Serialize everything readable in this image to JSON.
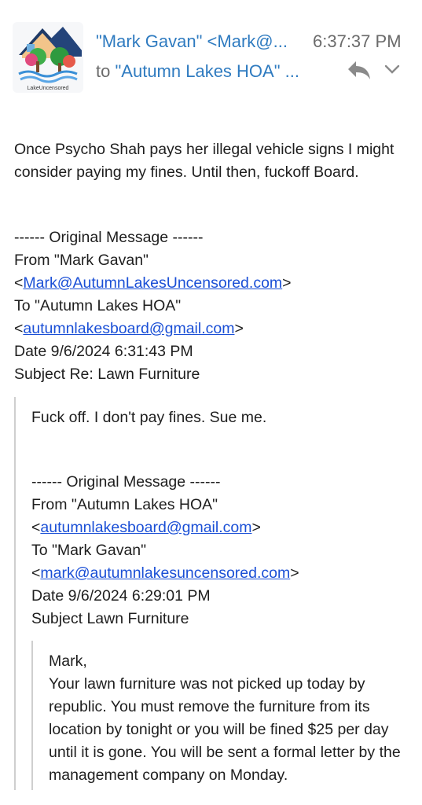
{
  "header": {
    "from": "\"Mark Gavan\" <Mark@...",
    "time": "6:37:37 PM",
    "to_prefix": "to",
    "to_name": "\"Autumn Lakes HOA\" ...",
    "avatar_caption": "LakeUncensored"
  },
  "message": {
    "body": "Once Psycho Shah pays her illegal vehicle signs I might consider paying my fines. Until then, fuckoff Board.",
    "original": {
      "separator": "------ Original Message ------",
      "from_label": "From \"Mark Gavan\"",
      "from_email": "Mark@AutumnLakesUncensored.com",
      "to_label": "To \"Autumn Lakes HOA\"",
      "to_email": "autumnlakesboard@gmail.com",
      "date": "Date 9/6/2024 6:31:43 PM",
      "subject": "Subject Re: Lawn Furniture"
    }
  },
  "quote1": {
    "body": "Fuck off. I don't pay fines. Sue me.",
    "original": {
      "separator": "------ Original Message ------",
      "from_label": "From \"Autumn Lakes HOA\"",
      "from_email": "autumnlakesboard@gmail.com",
      "to_label": "To \"Mark Gavan\"",
      "to_email": "mark@autumnlakesuncensored.com",
      "date": "Date 9/6/2024 6:29:01 PM",
      "subject": "Subject Lawn Furniture"
    }
  },
  "quote2": {
    "greeting": "Mark,",
    "body": "Your lawn furniture was not picked up today by republic. You must remove the furniture from its location by tonight or you will be fined $25 per day until it is gone. You will be sent a formal letter by the management company on Monday."
  },
  "colors": {
    "link": "#1a4fd6",
    "sender": "#2f7bc0",
    "meta": "#6b6b6b",
    "quote_bar": "#cfcfcf"
  },
  "icons": [
    "house-avatar-icon",
    "reply-icon",
    "chevron-down-icon"
  ]
}
